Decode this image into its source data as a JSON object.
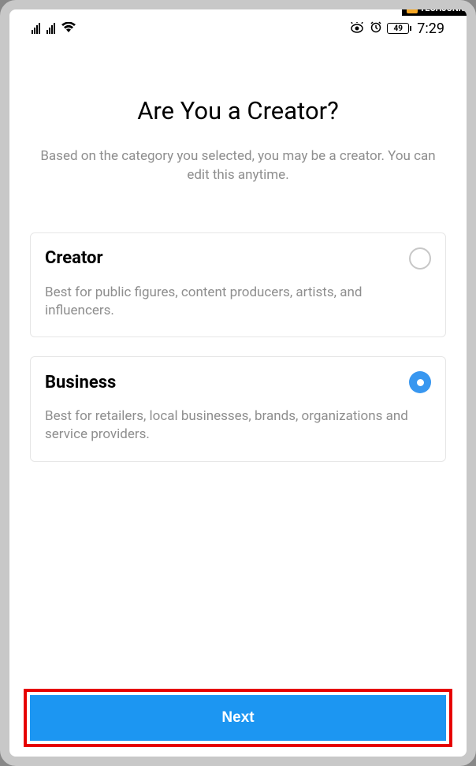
{
  "watermark": {
    "icon_text": "TJ",
    "label": "TECHJUNKIE"
  },
  "status_bar": {
    "battery_level": "49",
    "time": "7:29"
  },
  "page": {
    "title": "Are You a Creator?",
    "subtitle": "Based on the category you selected, you may be a creator. You can edit this anytime."
  },
  "options": {
    "creator": {
      "title": "Creator",
      "description": "Best for public figures, content producers, artists, and influencers.",
      "selected": false
    },
    "business": {
      "title": "Business",
      "description": "Best for retailers, local businesses, brands, organizations and service providers.",
      "selected": true
    }
  },
  "next_button": "Next"
}
